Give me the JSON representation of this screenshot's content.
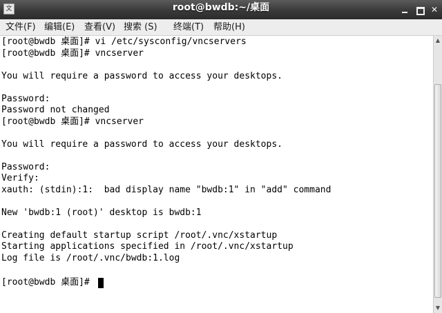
{
  "window": {
    "title": "root@bwdb:~/桌面",
    "app_icon_label": "文",
    "controls": {
      "minimize": "minimize",
      "maximize": "maximize",
      "close": "✕"
    }
  },
  "menubar": {
    "file": "文件(F)",
    "edit": "编辑(E)",
    "view": "查看(V)",
    "search": "搜索 (S)",
    "terminal": "终端(T)",
    "help": "帮助(H)"
  },
  "terminal": {
    "lines": [
      "[root@bwdb 桌面]# vi /etc/sysconfig/vncservers",
      "[root@bwdb 桌面]# vncserver",
      "",
      "You will require a password to access your desktops.",
      "",
      "Password:",
      "Password not changed",
      "[root@bwdb 桌面]# vncserver",
      "",
      "You will require a password to access your desktops.",
      "",
      "Password:",
      "Verify:",
      "xauth: (stdin):1:  bad display name \"bwdb:1\" in \"add\" command",
      "",
      "New 'bwdb:1 (root)' desktop is bwdb:1",
      "",
      "Creating default startup script /root/.vnc/xstartup",
      "Starting applications specified in /root/.vnc/xstartup",
      "Log file is /root/.vnc/bwdb:1.log",
      "",
      "[root@bwdb 桌面]# "
    ]
  },
  "scrollbar": {
    "up_arrow": "▲",
    "down_arrow": "▼"
  }
}
